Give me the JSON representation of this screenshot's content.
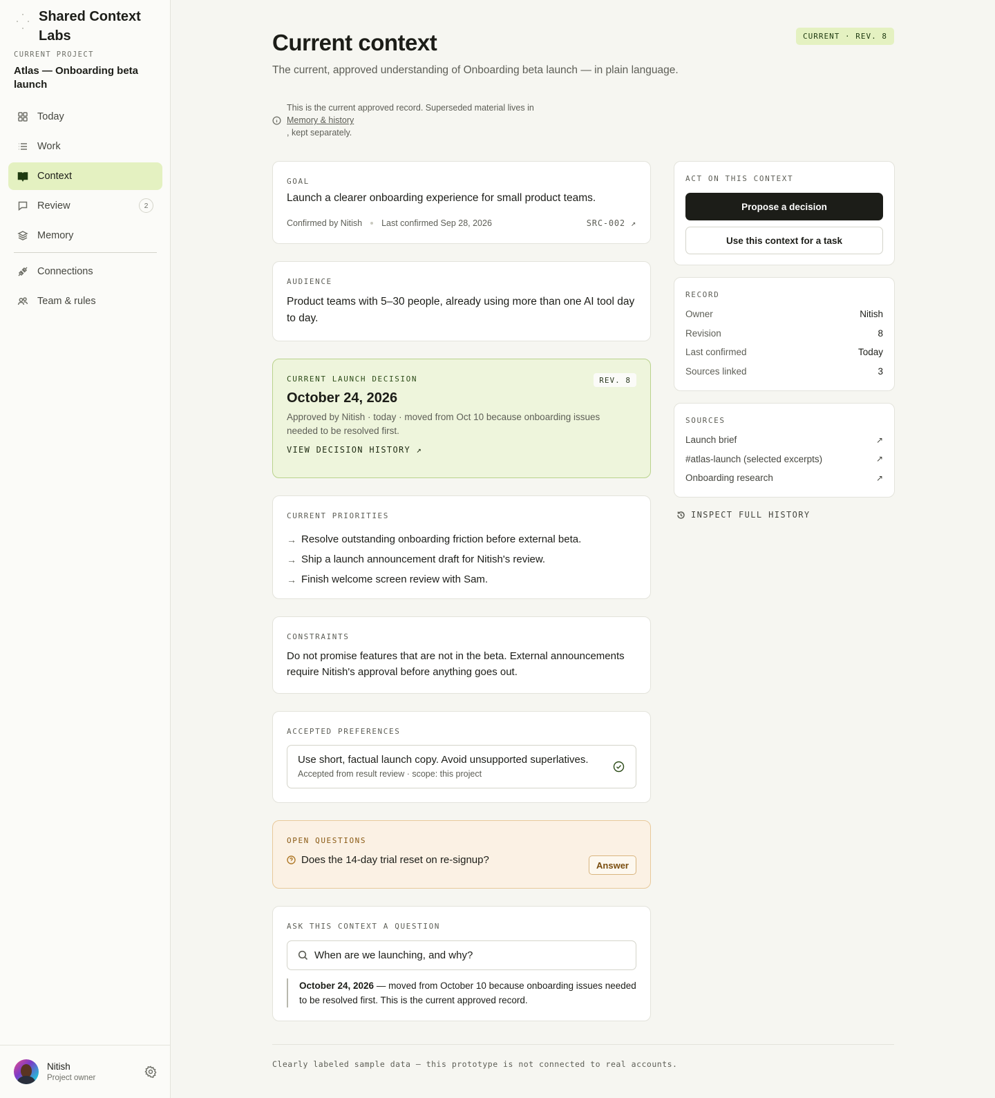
{
  "brand": {
    "name": "Shared Context Labs"
  },
  "project": {
    "label": "CURRENT PROJECT",
    "name": "Atlas — Onboarding beta launch"
  },
  "nav": {
    "items": [
      {
        "label": "Today",
        "icon": "grid-icon"
      },
      {
        "label": "Work",
        "icon": "list-icon"
      },
      {
        "label": "Context",
        "icon": "book-icon",
        "active": true
      },
      {
        "label": "Review",
        "icon": "review-icon",
        "badge": "2"
      },
      {
        "label": "Memory",
        "icon": "layers-icon"
      },
      {
        "label": "Connections",
        "icon": "plug-icon"
      },
      {
        "label": "Team & rules",
        "icon": "team-icon"
      }
    ]
  },
  "user": {
    "name": "Nitish",
    "role": "Project owner"
  },
  "header": {
    "title": "Current context",
    "status": "CURRENT · REV. 8",
    "subtitle": "The current, approved understanding of Onboarding beta launch — in plain language."
  },
  "notice": {
    "before": "This is the current approved record. Superseded material lives in",
    "link": "Memory & history",
    "after": ", kept separately."
  },
  "goal": {
    "label": "GOAL",
    "text": "Launch a clearer onboarding experience for small product teams.",
    "confirmed_by": "Confirmed by Nitish",
    "last_confirmed": "Last confirmed Sep 28, 2026",
    "source": "SRC-002 ↗"
  },
  "audience": {
    "label": "AUDIENCE",
    "text": "Product teams with 5–30 people, already using more than one AI tool day to day."
  },
  "decision": {
    "label": "CURRENT LAUNCH DECISION",
    "rev": "REV. 8",
    "date": "October 24, 2026",
    "note": "Approved by Nitish · today · moved from Oct 10 because onboarding issues needed to be resolved first.",
    "history_link": "VIEW DECISION HISTORY ↗"
  },
  "priorities": {
    "label": "CURRENT PRIORITIES",
    "items": [
      "Resolve outstanding onboarding friction before external beta.",
      "Ship a launch announcement draft for Nitish's review.",
      "Finish welcome screen review with Sam."
    ]
  },
  "constraints": {
    "label": "CONSTRAINTS",
    "text": "Do not promise features that are not in the beta. External announcements require Nitish's approval before anything goes out."
  },
  "preferences": {
    "label": "ACCEPTED PREFERENCES",
    "title": "Use short, factual launch copy. Avoid unsupported superlatives.",
    "sub": "Accepted from result review · scope: this project"
  },
  "questions": {
    "label": "OPEN QUESTIONS",
    "text": "Does the 14-day trial reset on re-signup?",
    "button": "Answer"
  },
  "ask": {
    "label": "ASK THIS CONTEXT A QUESTION",
    "query": "When are we launching, and why?",
    "answer_bold": "October 24, 2026",
    "answer_rest": " — moved from October 10 because onboarding issues needed to be resolved first. This is the current approved record."
  },
  "act": {
    "label": "ACT ON THIS CONTEXT",
    "primary": "Propose a decision",
    "secondary": "Use this context for a task"
  },
  "record": {
    "label": "RECORD",
    "rows": [
      {
        "k": "Owner",
        "v": "Nitish"
      },
      {
        "k": "Revision",
        "v": "8"
      },
      {
        "k": "Last confirmed",
        "v": "Today"
      },
      {
        "k": "Sources linked",
        "v": "3"
      }
    ]
  },
  "sources": {
    "label": "SOURCES",
    "items": [
      "Launch brief",
      "#atlas-launch (selected excerpts)",
      "Onboarding research"
    ],
    "ext": "↗"
  },
  "inspect": "INSPECT FULL HISTORY",
  "footer": "Clearly labeled sample data — this prototype is not connected to real accounts."
}
